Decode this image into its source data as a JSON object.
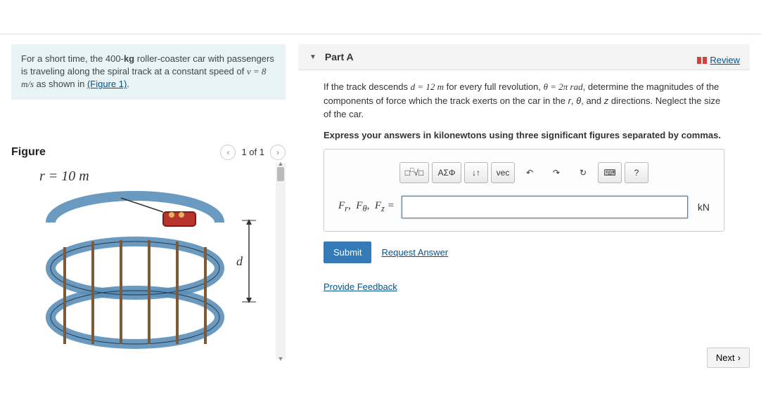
{
  "review": {
    "label": "Review"
  },
  "problem": {
    "text_prefix": "For a short time, the 400-",
    "text_mid1": " roller-coaster car with passengers is traveling along the spiral track at a constant speed of ",
    "text_mid2": " as shown in ",
    "figure_link": "(Figure 1)",
    "text_end": ".",
    "mass_unit": "kg",
    "v_expr": "v = 8 m/s"
  },
  "figure": {
    "title": "Figure",
    "counter": "1 of 1",
    "r_label": "r = 10 m",
    "d_label": "d"
  },
  "part": {
    "label": "Part A",
    "q1a": "If the track descends ",
    "q1b": " for every full revolution, ",
    "q1c": ", determine the magnitudes of the components of force which the track exerts on the car in the ",
    "q1d": ", and ",
    "q1e": " directions. Neglect the size of the car.",
    "d_expr": "d = 12 m",
    "theta_expr": "θ = 2π rad",
    "r_sym": "r",
    "theta_sym": "θ",
    "z_sym": "z",
    "q2": "Express your answers in kilonewtons using three significant figures separated by commas.",
    "answer_label": "Fr,  Fθ,  Fz =",
    "unit": "kN",
    "submit": "Submit",
    "request": "Request Answer"
  },
  "toolbar": {
    "templates": "□√□",
    "greek": "ΑΣΦ",
    "subsup": "↓↑",
    "vec": "vec",
    "undo": "↶",
    "redo": "↷",
    "reset": "↻",
    "keyboard": "⌨",
    "help": "?"
  },
  "feedback": {
    "label": "Provide Feedback"
  },
  "next": {
    "label": "Next"
  }
}
